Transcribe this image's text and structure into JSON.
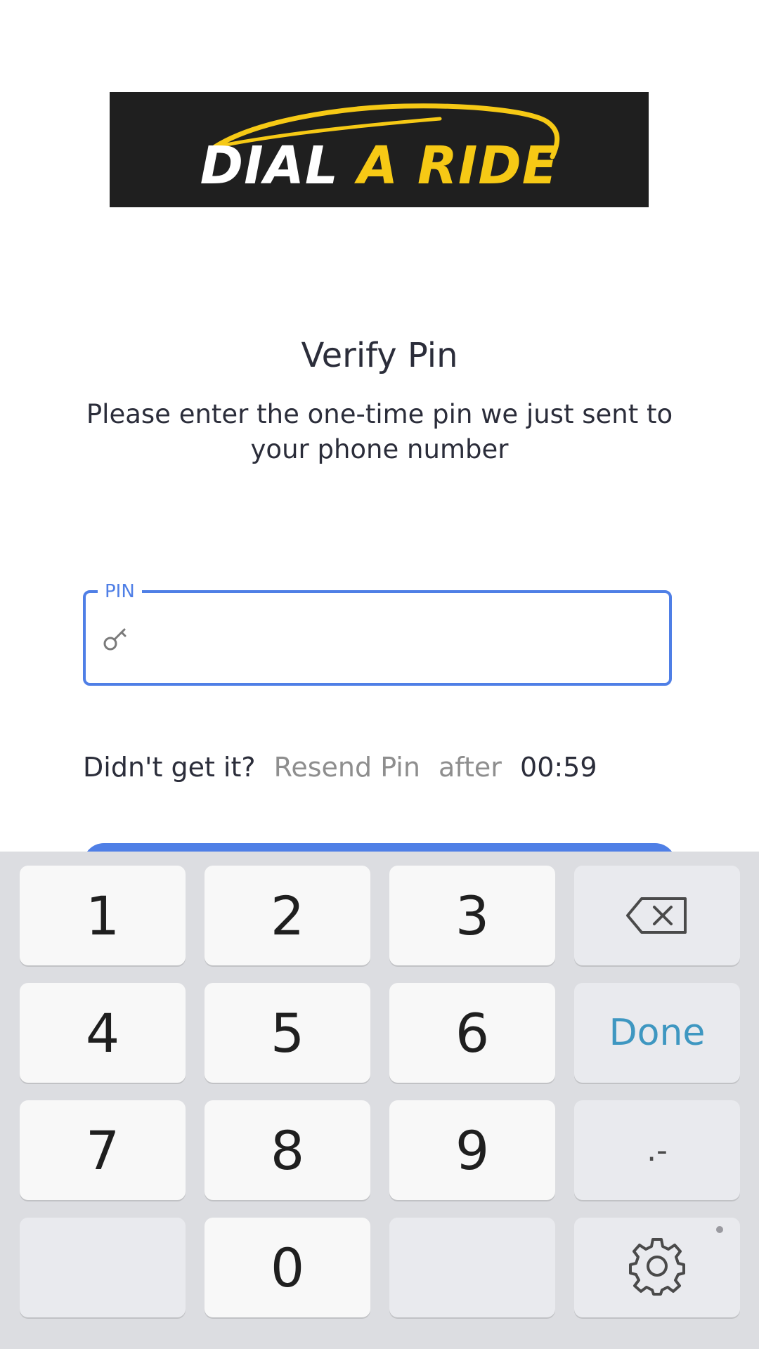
{
  "logo": {
    "text_white": "DIAL ",
    "text_yellow": "A RIDE"
  },
  "header": {
    "title": "Verify Pin",
    "subtitle": "Please enter the one-time pin we just sent to your phone number"
  },
  "pin_field": {
    "label": "PIN",
    "value": "",
    "icon": "key-icon"
  },
  "resend": {
    "prompt": "Didn't get it?",
    "link": "Resend Pin",
    "after": "after",
    "timer": "00:59"
  },
  "keyboard": {
    "keys": [
      "1",
      "2",
      "3",
      "4",
      "5",
      "6",
      "7",
      "8",
      "9",
      "0"
    ],
    "done_label": "Done",
    "dot_label": ".-",
    "icons": [
      "backspace-icon",
      "gear-icon"
    ]
  },
  "colors": {
    "accent": "#4f7fe6",
    "logo_background": "#1f1f1f",
    "logo_yellow": "#f6c915",
    "done_text": "#3e97c1"
  }
}
